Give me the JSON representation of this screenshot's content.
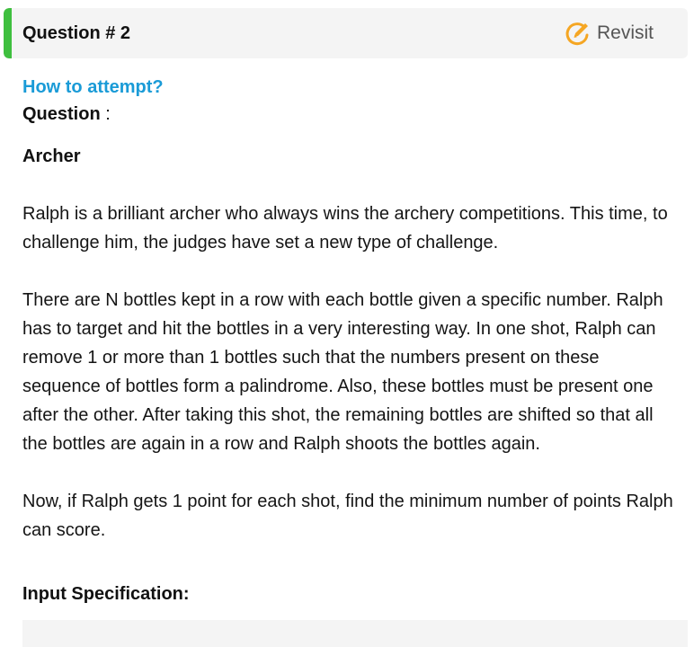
{
  "header": {
    "title": "Question # 2",
    "revisit_label": "Revisit",
    "accent_color": "#3fbf3f",
    "revisit_icon": "edit-pencil-circle-icon",
    "revisit_icon_color": "#f5a623"
  },
  "content": {
    "how_to_attempt": "How to attempt?",
    "question_label": "Question",
    "question_colon": " :",
    "problem_title": "Archer",
    "paragraphs": [
      "Ralph is a brilliant archer who always wins the archery competitions. This time, to challenge him, the judges have set a new type of challenge.",
      "There are N bottles kept in a row with each bottle given a specific number. Ralph has to target and hit the bottles in a very interesting way. In one shot, Ralph can remove 1 or more than 1 bottles such that the numbers present on these sequence of bottles form a palindrome. Also, these bottles must be present one after the other. After taking this shot, the remaining bottles are shifted so that all the bottles are again in a row and Ralph shoots the bottles again.",
      "Now, if Ralph gets 1 point for each shot, find the minimum number of points Ralph can score."
    ],
    "input_spec_heading": "Input Specification:"
  },
  "colors": {
    "link": "#1a9bd7",
    "header_bg": "#f4f4f4"
  }
}
